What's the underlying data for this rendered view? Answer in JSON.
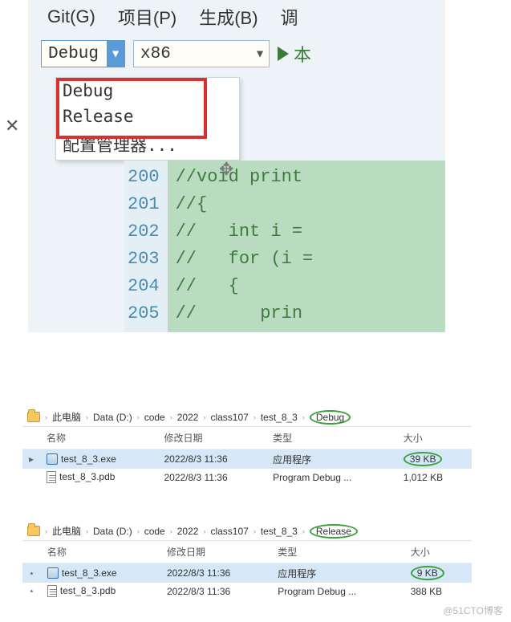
{
  "vs": {
    "menu": {
      "git": "Git(G)",
      "project": "项目(P)",
      "build": "生成(B)",
      "debug_menu": "调"
    },
    "config_combo": "Debug",
    "platform_combo": "x86",
    "run_label": "本",
    "dropdown": {
      "debug": "Debug",
      "release": "Release",
      "config_mgr": "配置管理器..."
    },
    "gutter": [
      "200",
      "201",
      "202",
      "203",
      "204",
      "205"
    ],
    "code": [
      "//void print",
      "//{",
      "//   int i = ",
      "//   for (i = ",
      "//   {",
      "//      prin"
    ]
  },
  "explorer1": {
    "crumbs": [
      "此电脑",
      "Data (D:)",
      "code",
      "2022",
      "class107",
      "test_8_3",
      "Debug"
    ],
    "headers": {
      "name": "名称",
      "date": "修改日期",
      "type": "类型",
      "size": "大小"
    },
    "rows": [
      {
        "sel": true,
        "icon": "exe",
        "name": "test_8_3.exe",
        "date": "2022/8/3 11:36",
        "type": "应用程序",
        "size": "39 KB",
        "size_oval": true
      },
      {
        "sel": false,
        "icon": "pdb",
        "name": "test_8_3.pdb",
        "date": "2022/8/3 11:36",
        "type": "Program Debug ...",
        "size": "1,012 KB",
        "size_oval": false
      }
    ]
  },
  "explorer2": {
    "crumbs": [
      "此电脑",
      "Data (D:)",
      "code",
      "2022",
      "class107",
      "test_8_3",
      "Release"
    ],
    "headers": {
      "name": "名称",
      "date": "修改日期",
      "type": "类型",
      "size": "大小"
    },
    "rows": [
      {
        "sel": true,
        "icon": "exe",
        "name": "test_8_3.exe",
        "date": "2022/8/3 11:36",
        "type": "应用程序",
        "size": "9 KB",
        "size_oval": true
      },
      {
        "sel": false,
        "icon": "pdb",
        "name": "test_8_3.pdb",
        "date": "2022/8/3 11:36",
        "type": "Program Debug ...",
        "size": "388 KB",
        "size_oval": false
      }
    ]
  },
  "watermark": "@51CTO博客"
}
